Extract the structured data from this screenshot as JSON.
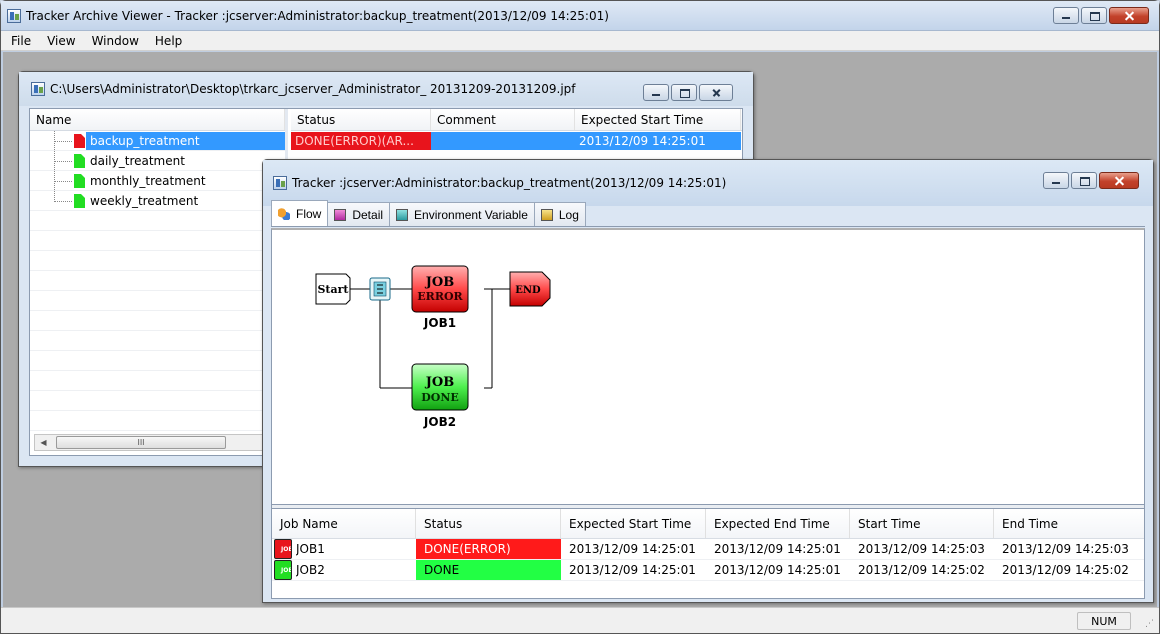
{
  "app": {
    "title": "Tracker Archive Viewer - Tracker :jcserver:Administrator:backup_treatment(2013/12/09 14:25:01)"
  },
  "menu": [
    "File",
    "View",
    "Window",
    "Help"
  ],
  "archive": {
    "title": "C:\\Users\\Administrator\\Desktop\\trkarc_jcserver_Administrator_ 20131209-20131209.jpf",
    "name_header": "Name",
    "list_headers": [
      "Status",
      "Comment",
      "Expected Start Time"
    ],
    "items": [
      {
        "name": "backup_treatment",
        "color": "#e8141c",
        "selected": true,
        "status": "DONE(ERROR)(AR...",
        "comment": "",
        "start": "2013/12/09 14:25:01"
      },
      {
        "name": "daily_treatment",
        "color": "#22dd22"
      },
      {
        "name": "monthly_treatment",
        "color": "#22dd22"
      },
      {
        "name": "weekly_treatment",
        "color": "#22dd22"
      }
    ],
    "scroll_thumb": "III"
  },
  "tracker": {
    "title": "Tracker :jcserver:Administrator:backup_treatment(2013/12/09 14:25:01)",
    "tabs": [
      {
        "label": "Flow",
        "icon": "flow-icon"
      },
      {
        "label": "Detail",
        "icon": "detail-icon"
      },
      {
        "label": "Environment Variable",
        "icon": "env-var-icon"
      },
      {
        "label": "Log",
        "icon": "log-icon"
      }
    ],
    "flow": {
      "start": "Start",
      "end": "END",
      "job1": {
        "top": "JOB",
        "state": "ERROR",
        "label": "JOB1"
      },
      "job2": {
        "top": "JOB",
        "state": "DONE",
        "label": "JOB2"
      }
    },
    "grid": {
      "headers": [
        "Job Name",
        "Status",
        "Expected Start Time",
        "Expected End Time",
        "Start Time",
        "End Time"
      ],
      "rows": [
        {
          "icon_text": "JOB",
          "icon_color": "#e8141c",
          "name": "JOB1",
          "status": "DONE(ERROR)",
          "status_bg": "#ff1a1a",
          "status_fg": "#ffffff",
          "exp_start": "2013/12/09 14:25:01",
          "exp_end": "2013/12/09 14:25:01",
          "start": "2013/12/09 14:25:03",
          "end": "2013/12/09 14:25:03"
        },
        {
          "icon_text": "JOB",
          "icon_color": "#22dd22",
          "name": "JOB2",
          "status": "DONE",
          "status_bg": "#22ff44",
          "status_fg": "#000000",
          "exp_start": "2013/12/09 14:25:01",
          "exp_end": "2013/12/09 14:25:01",
          "start": "2013/12/09 14:25:02",
          "end": "2013/12/09 14:25:02"
        }
      ]
    }
  },
  "status": {
    "num": "NUM"
  }
}
